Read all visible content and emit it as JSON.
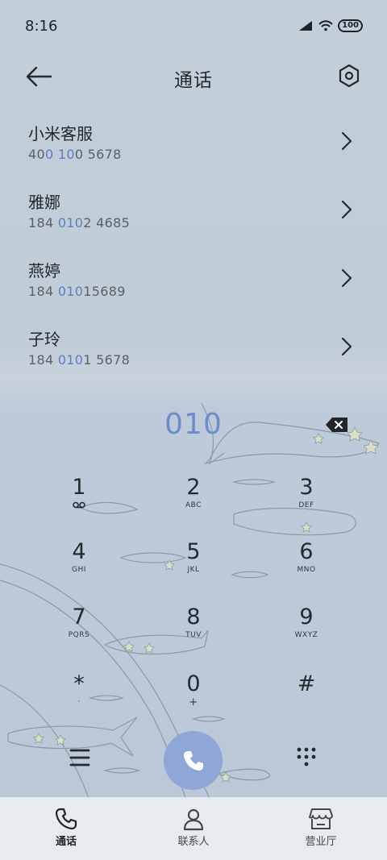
{
  "status_bar": {
    "time": "8:16",
    "battery_text": "100"
  },
  "header": {
    "title": "通话",
    "back_icon": "arrow-left-icon",
    "settings_icon": "hexagon-settings-icon"
  },
  "contacts": [
    {
      "name": "小米客服",
      "num_pre": "40",
      "num_hl1": "0",
      "num_mid": " ",
      "num_hl2": "10",
      "num_post": "0 5678"
    },
    {
      "name": "雅娜",
      "num_pre": "184 ",
      "num_hl1": "010",
      "num_mid": "",
      "num_hl2": "",
      "num_post": "2 4685"
    },
    {
      "name": "燕婷",
      "num_pre": "184 ",
      "num_hl1": "010",
      "num_mid": "",
      "num_hl2": "",
      "num_post": "15689"
    },
    {
      "name": "子玲",
      "num_pre": "184 ",
      "num_hl1": "010",
      "num_mid": "",
      "num_hl2": "",
      "num_post": "1 5678"
    }
  ],
  "dialer": {
    "digits": "010",
    "keys": [
      {
        "d": "1",
        "l": ""
      },
      {
        "d": "2",
        "l": "ABC"
      },
      {
        "d": "3",
        "l": "DEF"
      },
      {
        "d": "4",
        "l": "GHI"
      },
      {
        "d": "5",
        "l": "JKL"
      },
      {
        "d": "6",
        "l": "MNO"
      },
      {
        "d": "7",
        "l": "PQRS"
      },
      {
        "d": "8",
        "l": "TUV"
      },
      {
        "d": "9",
        "l": "WXYZ"
      },
      {
        "d": "*",
        "l": "·"
      },
      {
        "d": "0",
        "l": "+"
      },
      {
        "d": "#",
        "l": ""
      }
    ]
  },
  "nav": {
    "items": [
      {
        "label": "通话",
        "icon": "phone-icon",
        "active": true
      },
      {
        "label": "联系人",
        "icon": "person-icon",
        "active": false
      },
      {
        "label": "营业厅",
        "icon": "store-icon",
        "active": false
      }
    ]
  },
  "colors": {
    "accent": "#5a7fc4",
    "call_button": "#8fa7d6",
    "background": "#c0ccd6",
    "nav_background": "#e6ebef"
  }
}
